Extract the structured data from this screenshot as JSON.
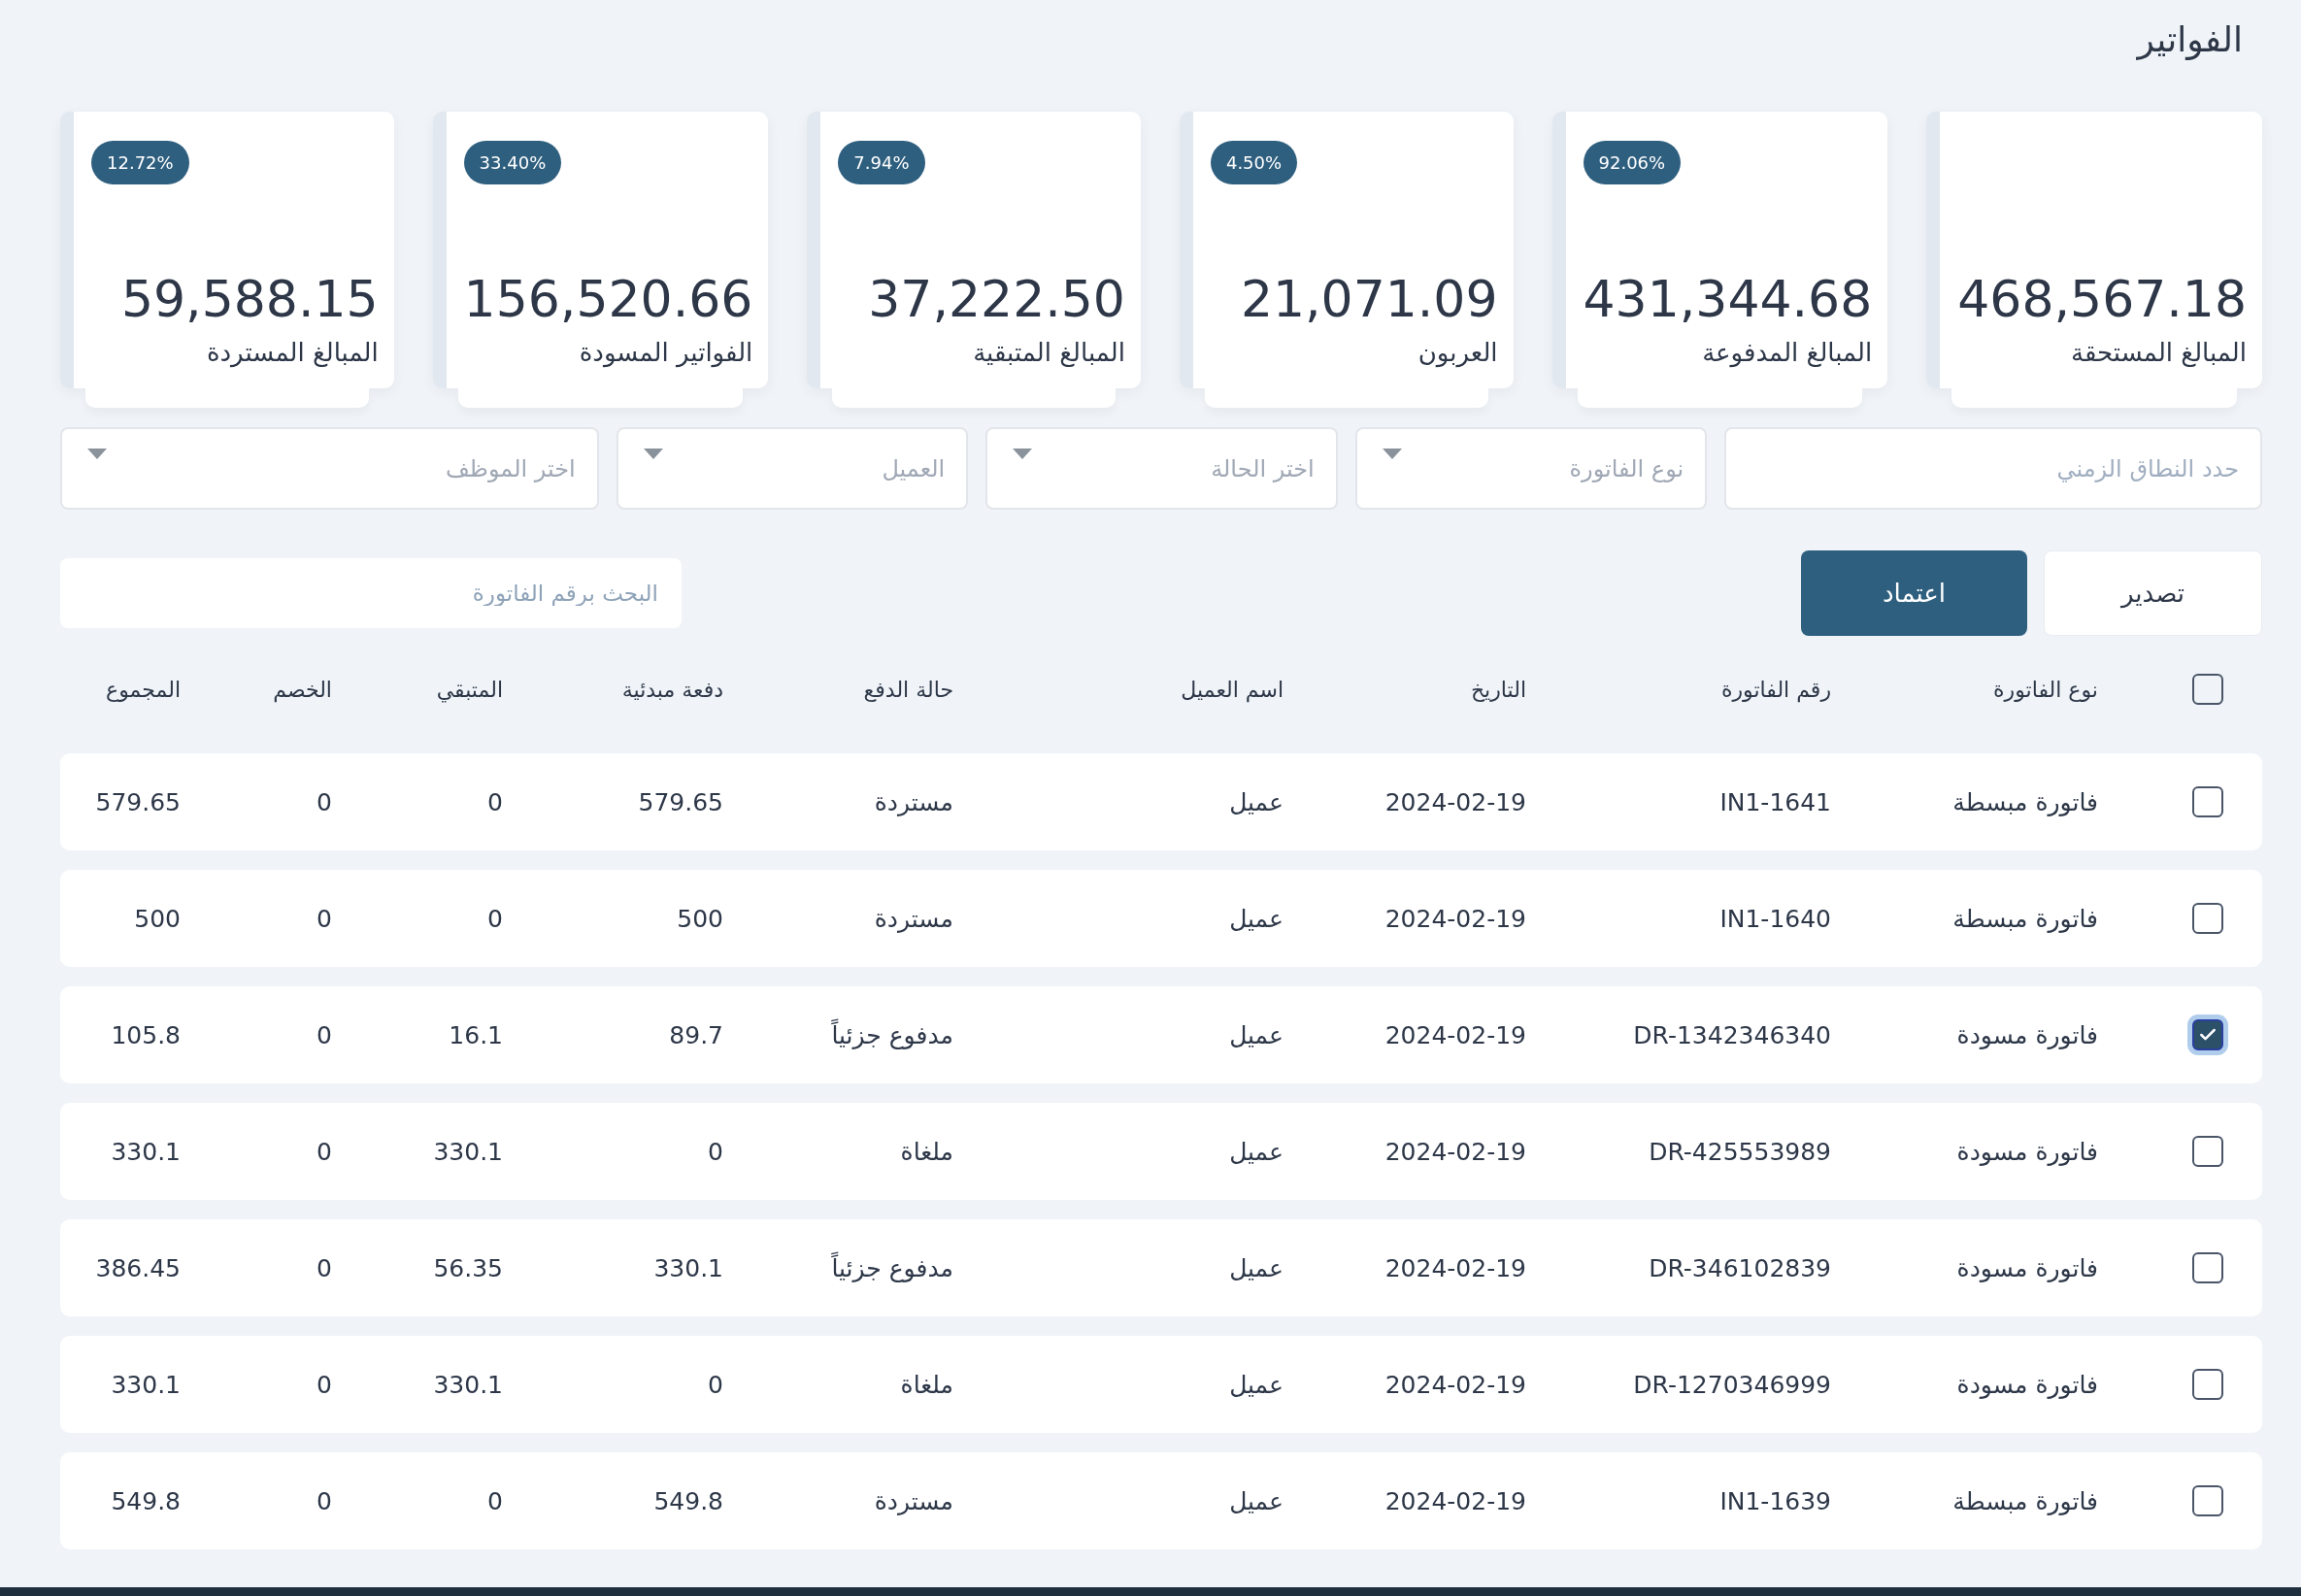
{
  "page": {
    "title": "الفواتير"
  },
  "cards": [
    {
      "label": "المبالغ المستحقة",
      "value": "468,567.18"
    },
    {
      "label": "المبالغ المدفوعة",
      "value": "431,344.68",
      "badge": "92.06%"
    },
    {
      "label": "العربون",
      "value": "21,071.09",
      "badge": "4.50%"
    },
    {
      "label": "المبالغ المتبقية",
      "value": "37,222.50",
      "badge": "7.94%"
    },
    {
      "label": "الفواتير المسودة",
      "value": "156,520.66",
      "badge": "33.40%"
    },
    {
      "label": "المبالغ المستردة",
      "value": "59,588.15",
      "badge": "12.72%"
    }
  ],
  "filters": [
    {
      "kind": "date",
      "placeholder": "حدد النطاق الزمني"
    },
    {
      "kind": "dropdown",
      "placeholder": "نوع الفاتورة"
    },
    {
      "kind": "dropdown",
      "placeholder": "اختر الحالة"
    },
    {
      "kind": "dropdown",
      "placeholder": "العميل"
    },
    {
      "kind": "dropdown",
      "placeholder": "اختر الموظف"
    }
  ],
  "actions": [
    {
      "kind": "secondary",
      "label": "تصدير"
    },
    {
      "kind": "primary",
      "label": "اعتماد"
    }
  ],
  "search": {
    "placeholder": "البحث برقم الفاتورة"
  },
  "table": {
    "select_all_checked": false,
    "columns": [
      "نوع الفاتورة",
      "رقم الفاتورة",
      "التاريخ",
      "اسم العميل",
      "حالة الدفع",
      "دفعة مبدئية",
      "المتبقي",
      "الخصم",
      "المجموع"
    ],
    "rows": [
      {
        "checked": false,
        "cells": [
          "فاتورة مبسطة",
          "IN1-1641",
          "2024-02-19",
          "عميل",
          "مستردة",
          "579.65",
          "0",
          "0",
          "579.65"
        ]
      },
      {
        "checked": false,
        "cells": [
          "فاتورة مبسطة",
          "IN1-1640",
          "2024-02-19",
          "عميل",
          "مستردة",
          "500",
          "0",
          "0",
          "500"
        ]
      },
      {
        "checked": true,
        "cells": [
          "فاتورة مسودة",
          "DR-1342346340",
          "2024-02-19",
          "عميل",
          "مدفوع جزئياً",
          "89.7",
          "16.1",
          "0",
          "105.8"
        ]
      },
      {
        "checked": false,
        "cells": [
          "فاتورة مسودة",
          "DR-425553989",
          "2024-02-19",
          "عميل",
          "ملغاة",
          "0",
          "330.1",
          "0",
          "330.1"
        ]
      },
      {
        "checked": false,
        "cells": [
          "فاتورة مسودة",
          "DR-346102839",
          "2024-02-19",
          "عميل",
          "مدفوع جزئياً",
          "330.1",
          "56.35",
          "0",
          "386.45"
        ]
      },
      {
        "checked": false,
        "cells": [
          "فاتورة مسودة",
          "DR-1270346999",
          "2024-02-19",
          "عميل",
          "ملغاة",
          "0",
          "330.1",
          "0",
          "330.1"
        ]
      },
      {
        "checked": false,
        "cells": [
          "فاتورة مبسطة",
          "IN1-1639",
          "2024-02-19",
          "عميل",
          "مستردة",
          "549.8",
          "0",
          "0",
          "549.8"
        ]
      }
    ]
  }
}
